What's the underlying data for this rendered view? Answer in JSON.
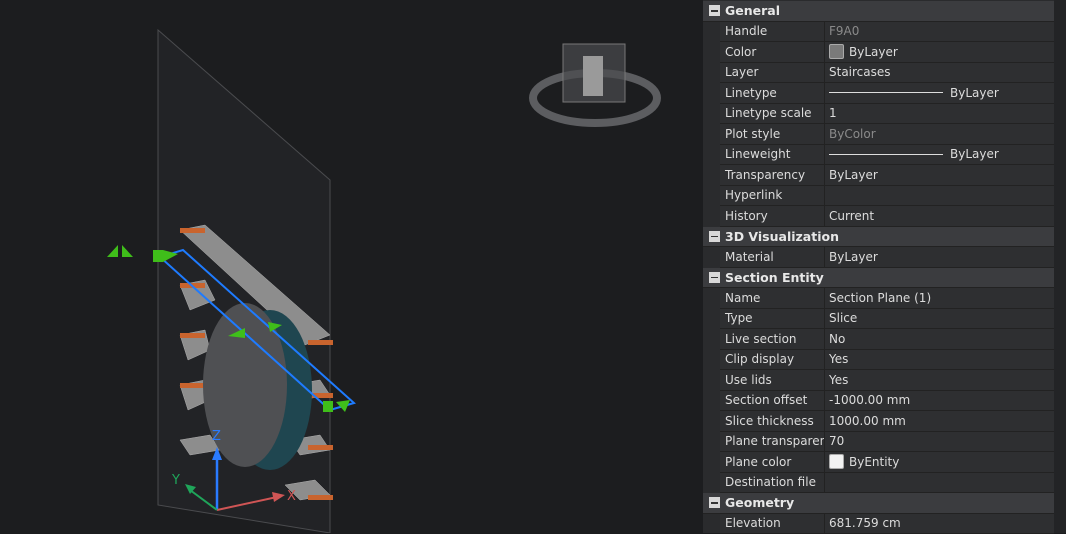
{
  "viewport": {
    "axes": {
      "x": "X",
      "y": "Y",
      "z": "Z"
    },
    "viewcube_icon": "viewcube-icon"
  },
  "sections": [
    {
      "title": "General",
      "rows": [
        {
          "label": "Handle",
          "value": "F9A0",
          "dim": true
        },
        {
          "label": "Color",
          "value": "ByLayer",
          "swatch": "#7a7a7a"
        },
        {
          "label": "Layer",
          "value": "Staircases"
        },
        {
          "label": "Linetype",
          "value": "ByLayer",
          "line": true
        },
        {
          "label": "Linetype scale",
          "value": "1"
        },
        {
          "label": "Plot style",
          "value": "ByColor",
          "dim": true
        },
        {
          "label": "Lineweight",
          "value": "ByLayer",
          "line": true
        },
        {
          "label": "Transparency",
          "value": "ByLayer"
        },
        {
          "label": "Hyperlink",
          "value": ""
        },
        {
          "label": "History",
          "value": "Current"
        }
      ]
    },
    {
      "title": "3D Visualization",
      "rows": [
        {
          "label": "Material",
          "value": "ByLayer"
        }
      ]
    },
    {
      "title": "Section Entity",
      "rows": [
        {
          "label": "Name",
          "value": "Section Plane (1)"
        },
        {
          "label": "Type",
          "value": "Slice"
        },
        {
          "label": "Live section",
          "value": "No"
        },
        {
          "label": "Clip display",
          "value": "Yes"
        },
        {
          "label": "Use lids",
          "value": "Yes"
        },
        {
          "label": "Section offset",
          "value": "-1000.00 mm"
        },
        {
          "label": "Slice thickness",
          "value": "1000.00 mm"
        },
        {
          "label": "Plane transparency",
          "value": "70"
        },
        {
          "label": "Plane color",
          "value": "ByEntity",
          "swatch": "#f2f2f2"
        },
        {
          "label": "Destination file",
          "value": ""
        }
      ]
    },
    {
      "title": "Geometry",
      "rows": [
        {
          "label": "Elevation",
          "value": "681.759 cm"
        }
      ]
    }
  ]
}
